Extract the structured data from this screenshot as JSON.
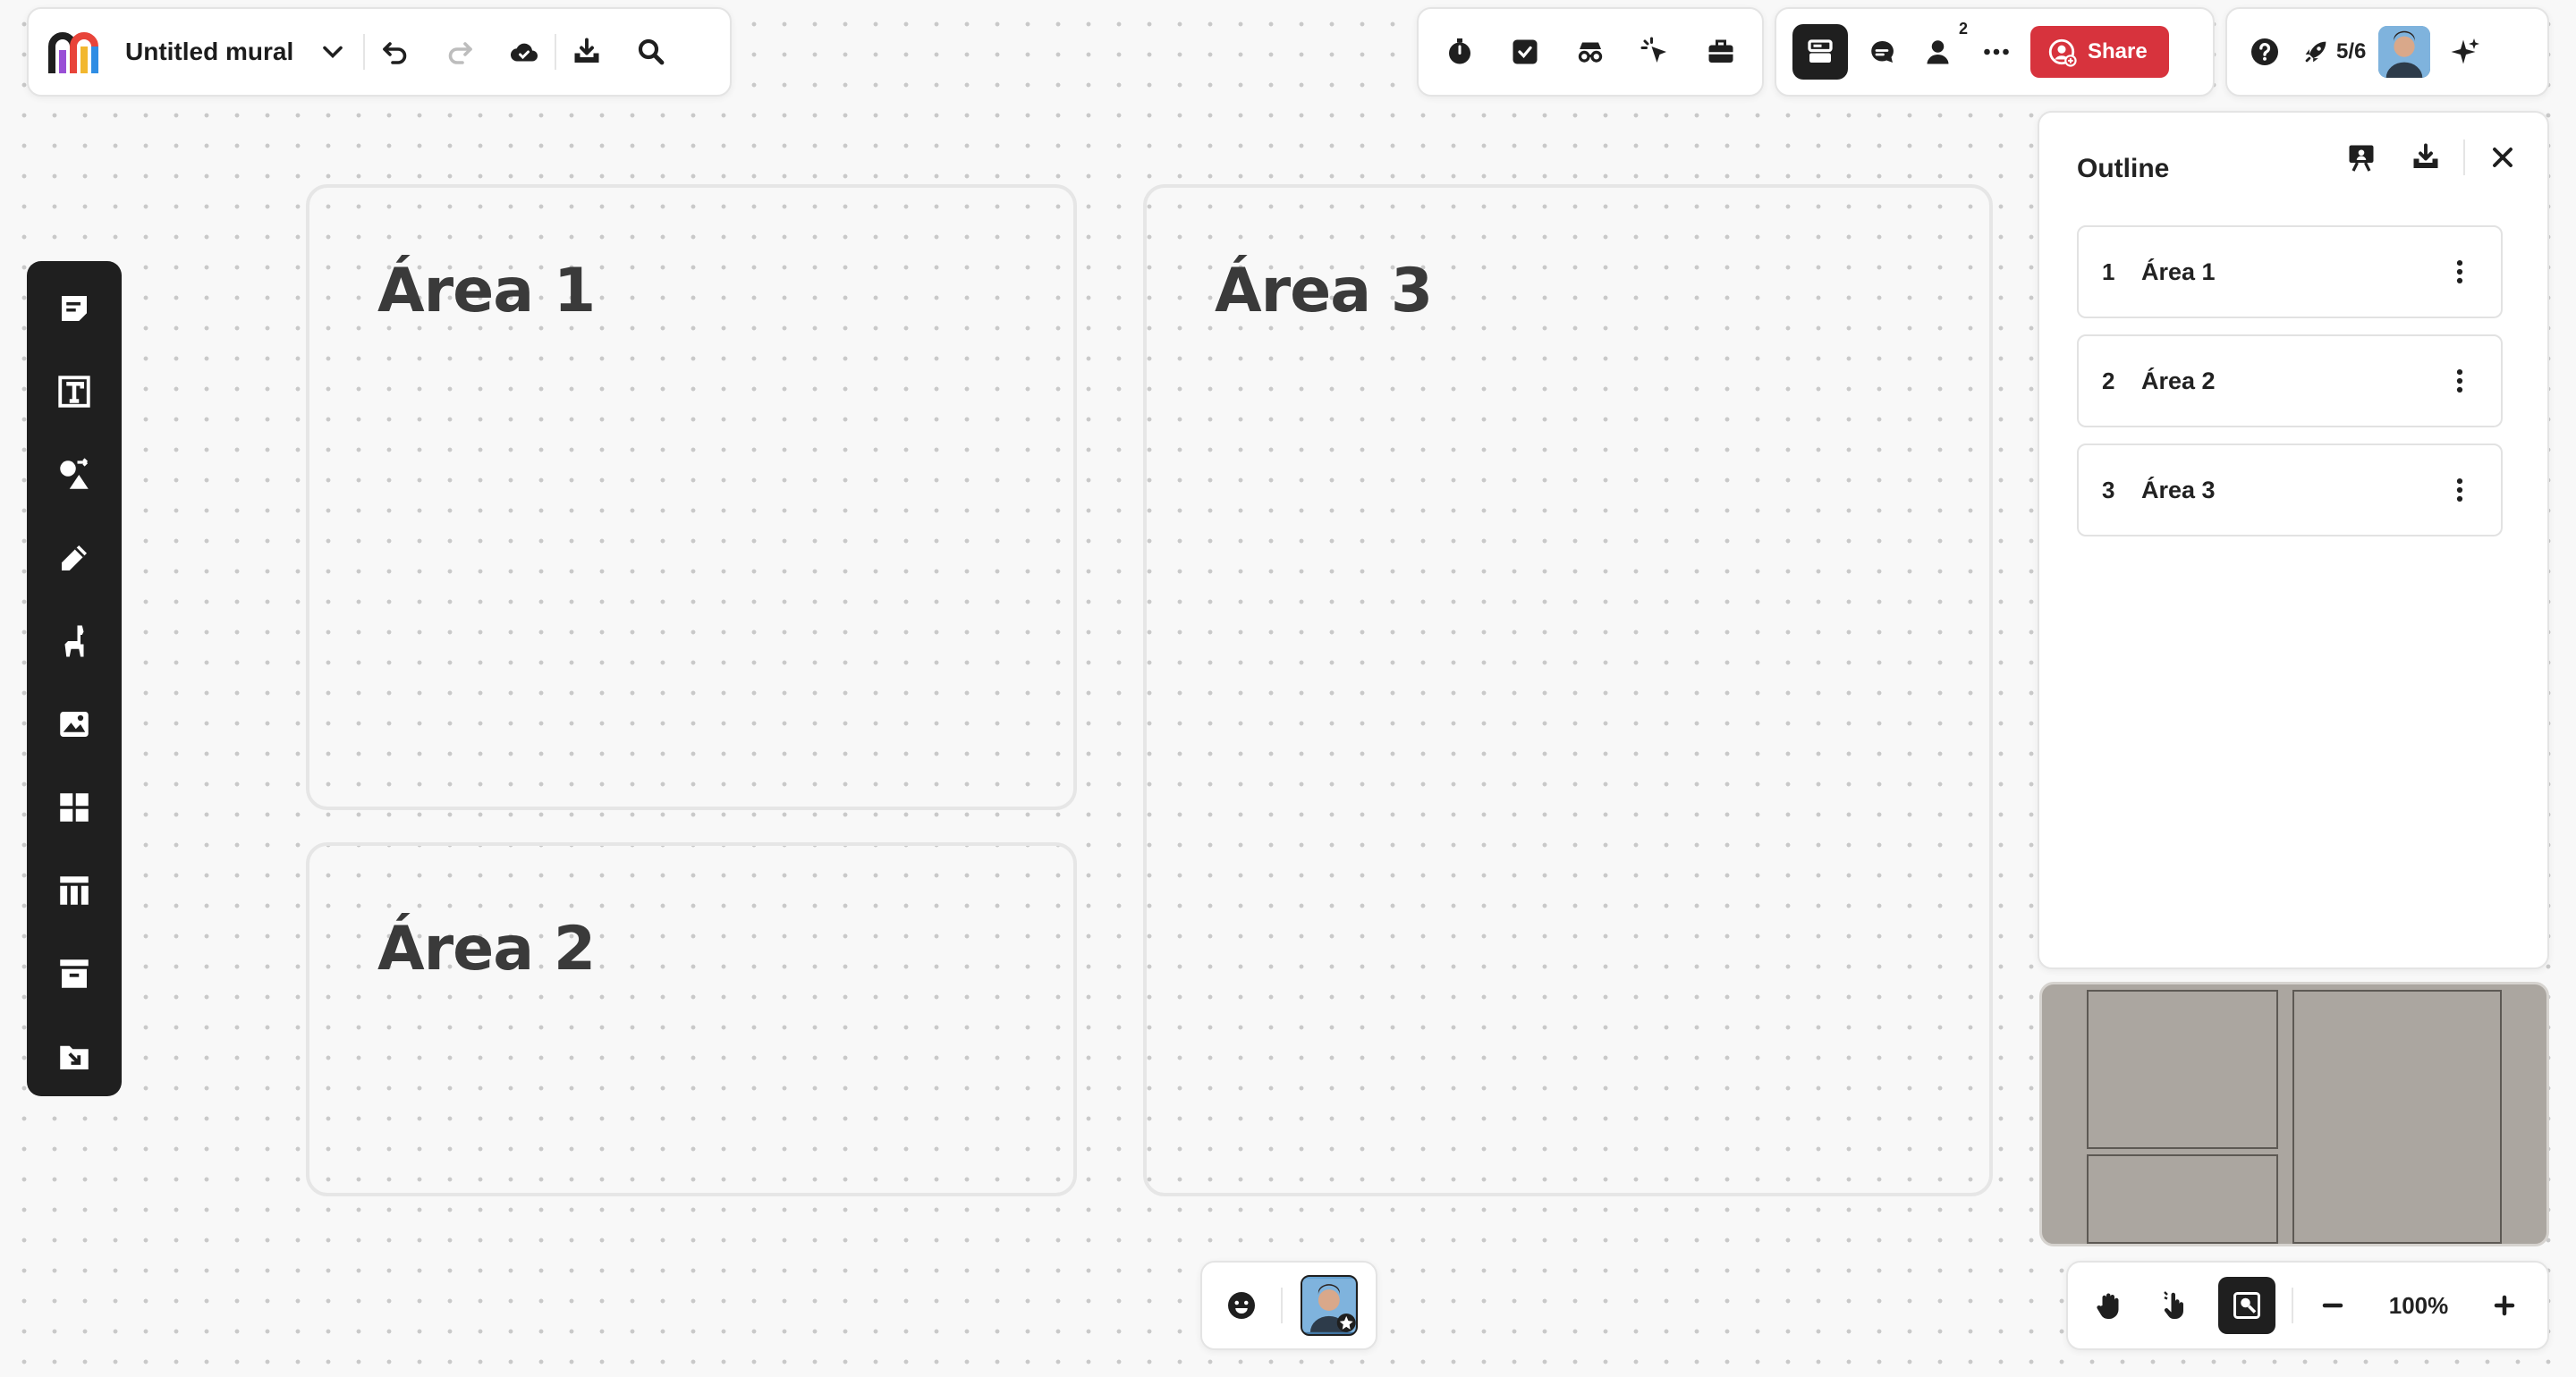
{
  "mural": {
    "title": "Untitled mural",
    "logo": "mural-logo"
  },
  "toolbar_top": {
    "undo_icon": "undo-icon",
    "redo_icon": "redo-icon",
    "cloud_icon": "cloud-saved-icon",
    "download_icon": "download-icon",
    "search_icon": "search-icon"
  },
  "tools_top": [
    "timer-icon",
    "voting-icon",
    "private-mode-icon",
    "cursor-icon",
    "toolkit-icon"
  ],
  "collab": {
    "members_count": "2",
    "share_label": "Share"
  },
  "help": {
    "progress": "5/6"
  },
  "left_tools": [
    "sticky-note-icon",
    "text-icon",
    "shapes-icon",
    "pen-icon",
    "llama-icon",
    "image-icon",
    "templates-icon",
    "table-icon",
    "archive-icon",
    "import-icon"
  ],
  "areas": [
    {
      "title": "Área 1"
    },
    {
      "title": "Área 2"
    },
    {
      "title": "Área 3"
    }
  ],
  "outline": {
    "title": "Outline",
    "items": [
      {
        "num": "1",
        "label": "Área 1"
      },
      {
        "num": "2",
        "label": "Área 2"
      },
      {
        "num": "3",
        "label": "Área 3"
      }
    ]
  },
  "zoom": {
    "value": "100%"
  },
  "colors": {
    "accent": "#d7333d",
    "dark": "#1f1f1f",
    "minimap": "#aba6a0"
  }
}
